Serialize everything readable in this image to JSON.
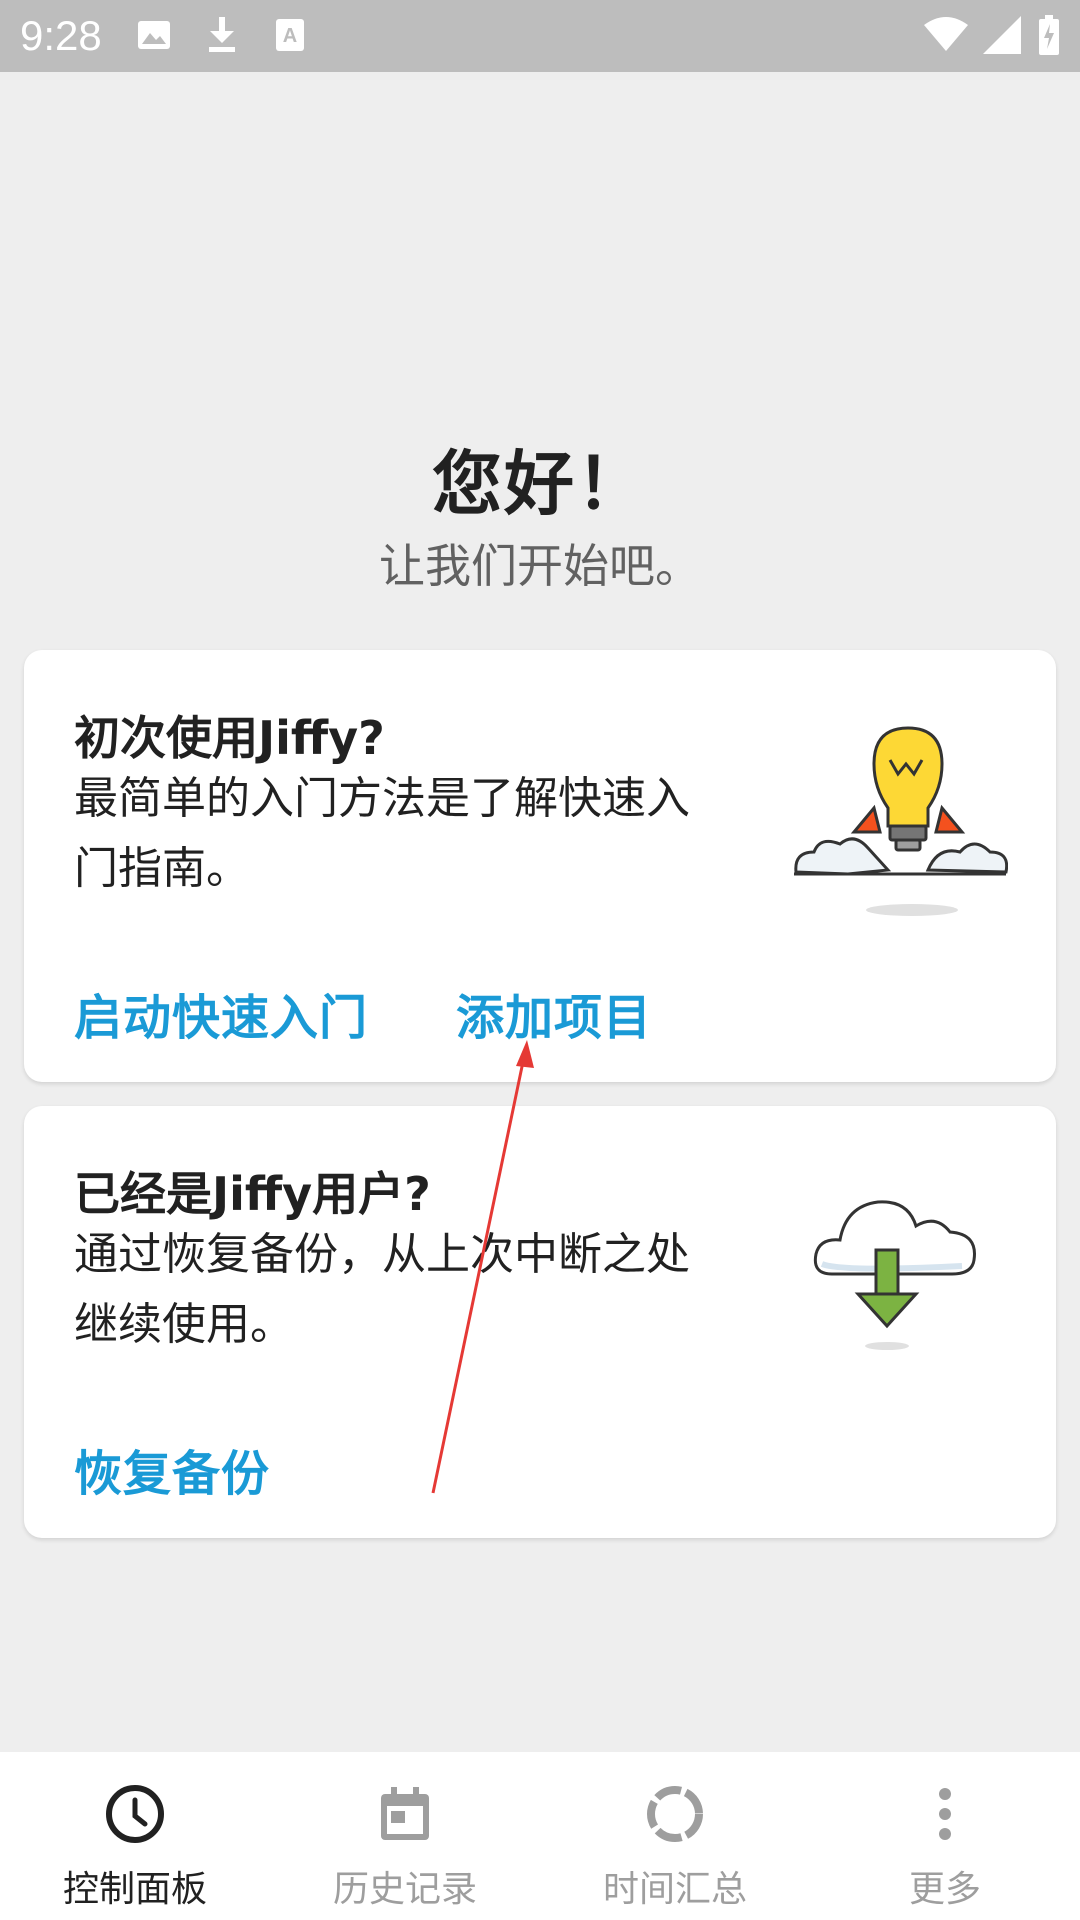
{
  "status_bar": {
    "time": "9:28",
    "left_icons": [
      "image-icon",
      "download-icon",
      "text-icon"
    ],
    "right_icons": [
      "wifi-icon",
      "signal-icon",
      "battery-icon"
    ]
  },
  "greeting": {
    "title": "您好！",
    "subtitle": "让我们开始吧。"
  },
  "cards": [
    {
      "title": "初次使用Jiffy?",
      "body": "最简单的入门方法是了解快速入门指南。",
      "actions": [
        "启动快速入门",
        "添加项目"
      ],
      "illustration": "lightbulb-rocket-icon"
    },
    {
      "title": "已经是Jiffy用户?",
      "body": "通过恢复备份，从上次中断之处继续使用。",
      "actions": [
        "恢复备份"
      ],
      "illustration": "cloud-download-icon"
    }
  ],
  "bottom_nav": {
    "items": [
      {
        "label": "控制面板",
        "icon": "clock-icon",
        "active": true
      },
      {
        "label": "历史记录",
        "icon": "calendar-icon",
        "active": false
      },
      {
        "label": "时间汇总",
        "icon": "circle-progress-icon",
        "active": false
      },
      {
        "label": "更多",
        "icon": "more-vert-icon",
        "active": false
      }
    ]
  },
  "colors": {
    "accent": "#1a9ad6",
    "background": "#eeeeee",
    "status_bar": "#bdbdbd",
    "annotation_arrow": "#e53935"
  }
}
